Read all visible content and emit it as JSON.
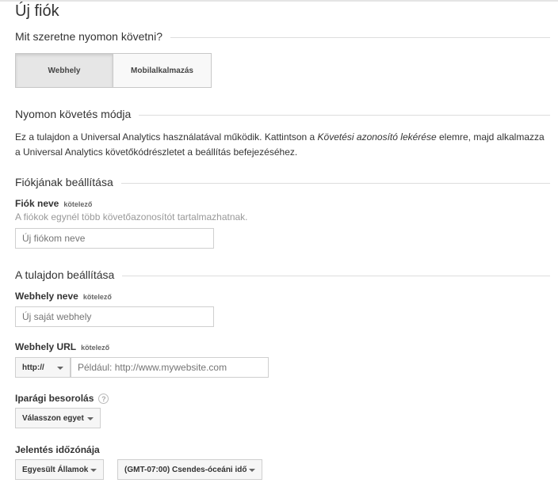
{
  "page_title": "Új fiók",
  "track_section": {
    "heading": "Mit szeretne nyomon követni?",
    "tabs": [
      {
        "label": "Webhely",
        "selected": true
      },
      {
        "label": "Mobilalkalmazás",
        "selected": false
      }
    ]
  },
  "tracking_method": {
    "heading": "Nyomon követés módja",
    "text_before": "Ez a tulajdon a Universal Analytics használatával működik. Kattintson a ",
    "text_emphasis": "Követési azonosító lekérése",
    "text_after": " elemre, majd alkalmazza a Universal Analytics követőkódrészletet a beállítás befejezéséhez."
  },
  "account_settings": {
    "heading": "Fiókjának beállítása",
    "account_name_label": "Fiók neve",
    "required_label": "kötelező",
    "account_name_hint": "A fiókok egynél több követőazonosítót tartalmazhatnak.",
    "account_name_placeholder": "Új fiókom neve"
  },
  "property_settings": {
    "heading": "A tulajdon beállítása",
    "website_name_label": "Webhely neve",
    "website_name_required": "kötelező",
    "website_name_placeholder": "Új saját webhely",
    "website_url_label": "Webhely URL",
    "website_url_required": "kötelező",
    "protocol_value": "http://",
    "website_url_placeholder": "Például: http://www.mywebsite.com",
    "industry_label": "Iparági besorolás",
    "help_icon_glyph": "?",
    "industry_value": "Válasszon egyet",
    "timezone_label": "Jelentés időzónája",
    "timezone_country": "Egyesült Államok",
    "timezone_zone": "(GMT-07:00) Csendes-óceáni idő"
  }
}
